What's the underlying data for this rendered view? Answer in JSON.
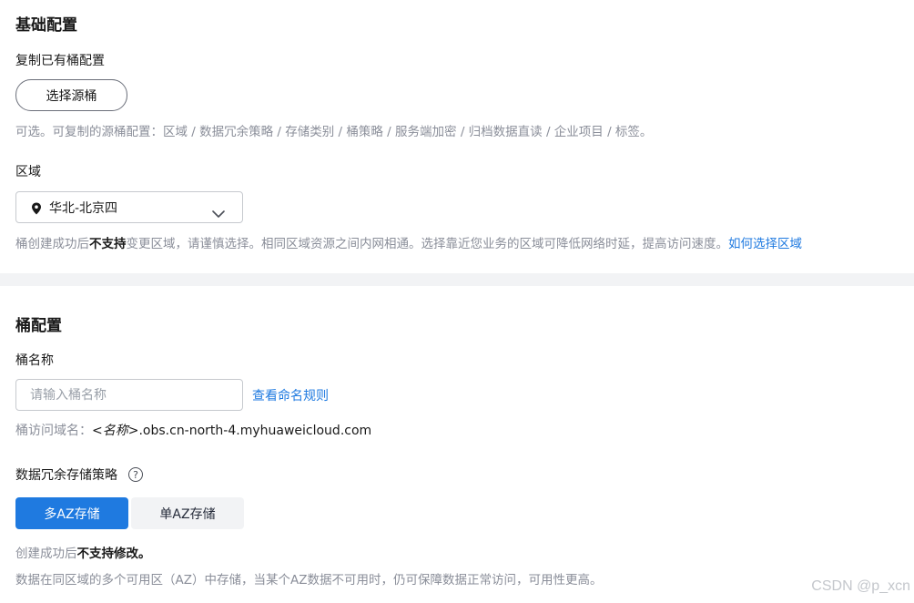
{
  "basic": {
    "title": "基础配置",
    "copy_label": "复制已有桶配置",
    "select_source_btn": "选择源桶",
    "copy_hint": "可选。可复制的源桶配置：区域 / 数据冗余策略 / 存储类别 / 桶策略 / 服务端加密 / 归档数据直读 / 企业项目 / 标签。",
    "region_label": "区域",
    "region_value": "华北-北京四",
    "region_hint_prefix": "桶创建成功后",
    "region_hint_bold": "不支持",
    "region_hint_suffix": "变更区域，请谨慎选择。相同区域资源之间内网相通。选择靠近您业务的区域可降低网络时延，提高访问速度。",
    "region_help_link": "如何选择区域"
  },
  "bucket": {
    "title": "桶配置",
    "name_label": "桶名称",
    "name_value": "",
    "name_placeholder": "请输入桶名称",
    "naming_rules_link": "查看命名规则",
    "domain_prefix": "桶访问域名：",
    "domain_name_part": "<名称>",
    "domain_suffix": ".obs.cn-north-4.myhuaweicloud.com",
    "redundancy_label": "数据冗余存储策略",
    "help_icon_glyph": "?",
    "redundancy_options": [
      "多AZ存储",
      "单AZ存储"
    ],
    "redundancy_selected": "多AZ存储",
    "redundancy_note_prefix": "创建成功后",
    "redundancy_note_bold": "不支持修改。",
    "redundancy_desc": "数据在同区域的多个可用区（AZ）中存储，当某个AZ数据不可用时，仍可保障数据正常访问，可用性更高。"
  },
  "watermark": "CSDN @p_xcn",
  "colors": {
    "accent": "#1f7ae0",
    "divider": "#f2f3f5",
    "hint_text": "#8a8e99"
  },
  "icons": {
    "region_pin": "location-pin-icon",
    "dropdown": "chevron-down-icon",
    "help": "question-circle-icon"
  }
}
